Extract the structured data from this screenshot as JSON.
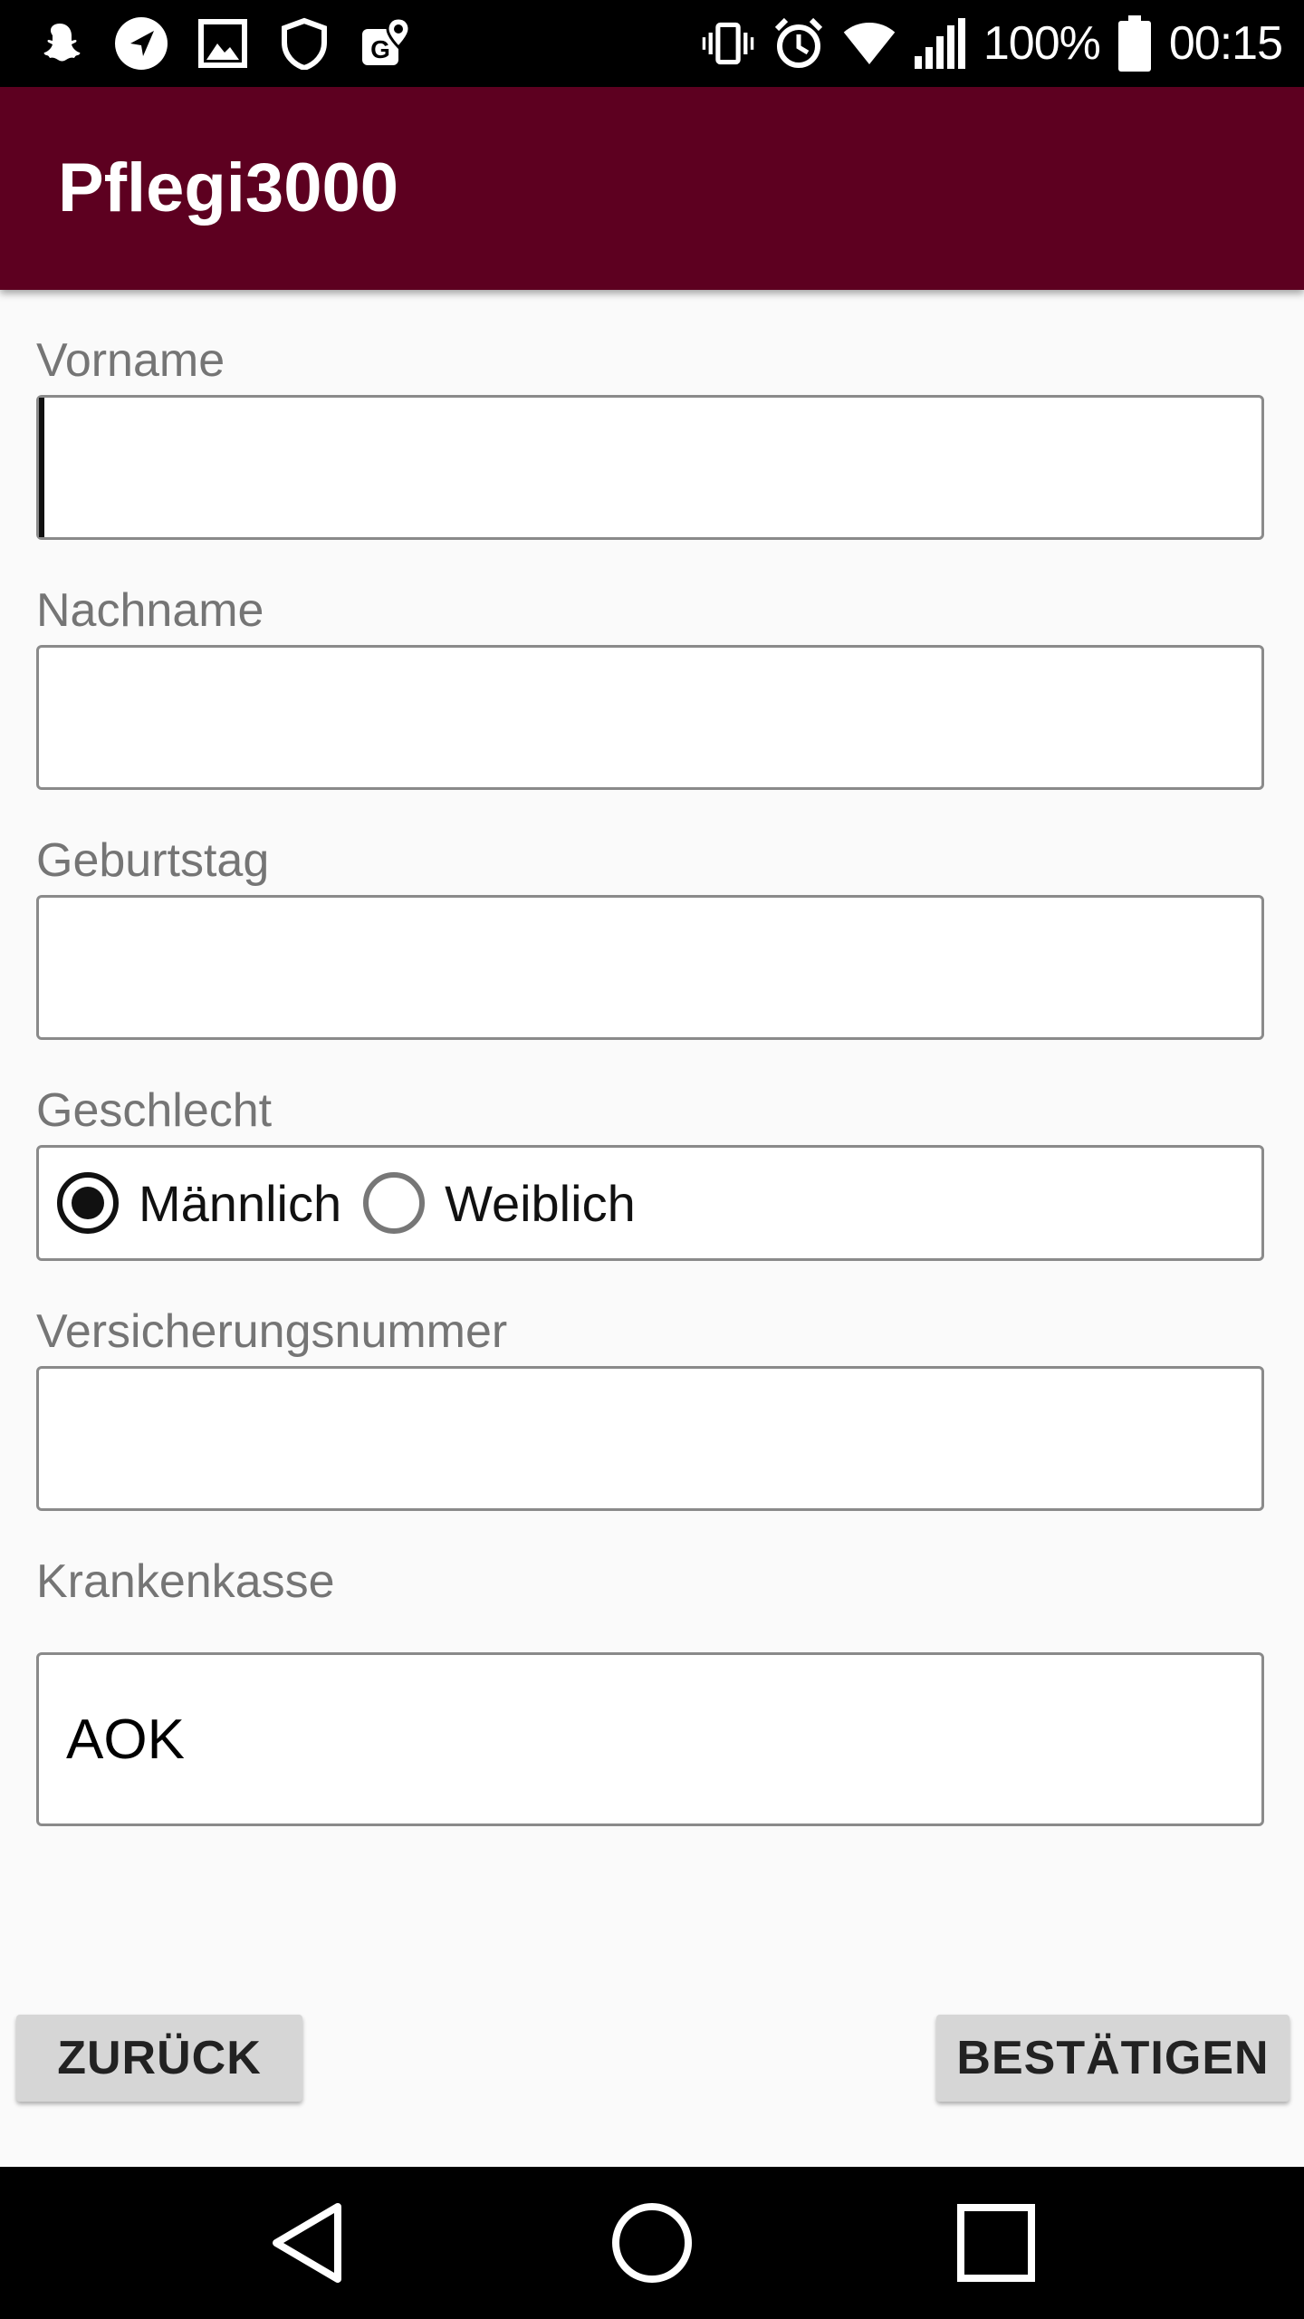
{
  "status_bar": {
    "battery_percent": "100%",
    "time": "00:15",
    "left_icons": [
      "snapchat-icon",
      "navigation-icon",
      "image-icon",
      "shield-icon",
      "maps-icon"
    ],
    "right_icons": [
      "vibrate-icon",
      "alarm-icon",
      "wifi-icon",
      "signal-icon",
      "battery-icon"
    ]
  },
  "app_bar": {
    "title": "Pflegi3000",
    "background_color": "#5d0020"
  },
  "form": {
    "first_name": {
      "label": "Vorname",
      "value": ""
    },
    "last_name": {
      "label": "Nachname",
      "value": ""
    },
    "birthday": {
      "label": "Geburtstag",
      "value": ""
    },
    "gender": {
      "label": "Geschlecht",
      "options": [
        {
          "label": "Männlich",
          "selected": true
        },
        {
          "label": "Weiblich",
          "selected": false
        }
      ]
    },
    "insurance_number": {
      "label": "Versicherungsnummer",
      "value": ""
    },
    "health_insurance": {
      "label": "Krankenkasse",
      "selected_value": "AOK"
    }
  },
  "buttons": {
    "back_label": "ZURÜCK",
    "confirm_label": "BESTÄTIGEN"
  },
  "nav_bar": {
    "icons": [
      "back-icon",
      "home-icon",
      "recents-icon"
    ]
  }
}
